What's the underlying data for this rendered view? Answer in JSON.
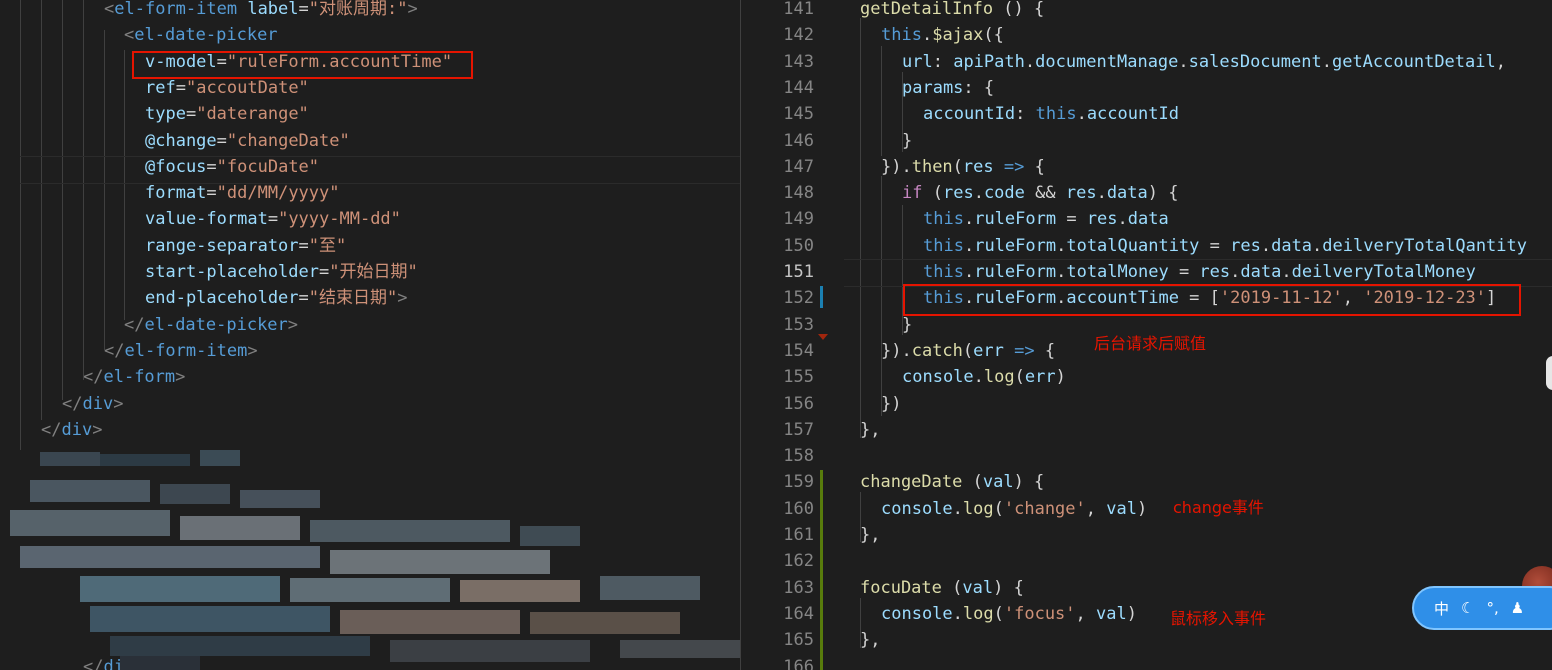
{
  "left_code": [
    [
      [
        "pn",
        "<"
      ],
      [
        "tg",
        "el-form-item"
      ],
      [
        "op",
        " "
      ],
      [
        "at",
        "label"
      ],
      [
        "op",
        "="
      ],
      [
        "st",
        "\"对账周期:\""
      ],
      [
        "pn",
        ">"
      ]
    ],
    [
      [
        "pn",
        "<"
      ],
      [
        "tg",
        "el-date-picker"
      ]
    ],
    [
      [
        "at",
        "v-model"
      ],
      [
        "op",
        "="
      ],
      [
        "st",
        "\"ruleForm.accountTime\""
      ]
    ],
    [
      [
        "at",
        "ref"
      ],
      [
        "op",
        "="
      ],
      [
        "st",
        "\"accoutDate\""
      ]
    ],
    [
      [
        "at",
        "type"
      ],
      [
        "op",
        "="
      ],
      [
        "st",
        "\"daterange\""
      ]
    ],
    [
      [
        "at",
        "@change"
      ],
      [
        "op",
        "="
      ],
      [
        "st",
        "\"changeDate\""
      ]
    ],
    [
      [
        "at",
        "@focus"
      ],
      [
        "op",
        "="
      ],
      [
        "st",
        "\"focuDate\""
      ]
    ],
    [
      [
        "at",
        "format"
      ],
      [
        "op",
        "="
      ],
      [
        "st",
        "\"dd/MM/yyyy\""
      ]
    ],
    [
      [
        "at",
        "value-format"
      ],
      [
        "op",
        "="
      ],
      [
        "st",
        "\"yyyy-MM-dd\""
      ]
    ],
    [
      [
        "at",
        "range-separator"
      ],
      [
        "op",
        "="
      ],
      [
        "st",
        "\"至\""
      ]
    ],
    [
      [
        "at",
        "start-placeholder"
      ],
      [
        "op",
        "="
      ],
      [
        "st",
        "\"开始日期\""
      ]
    ],
    [
      [
        "at",
        "end-placeholder"
      ],
      [
        "op",
        "="
      ],
      [
        "st",
        "\"结束日期\""
      ],
      [
        "pn",
        ">"
      ]
    ],
    [
      [
        "pn",
        "</"
      ],
      [
        "tg",
        "el-date-picker"
      ],
      [
        "pn",
        ">"
      ]
    ],
    [
      [
        "pn",
        "</"
      ],
      [
        "tg",
        "el-form-item"
      ],
      [
        "pn",
        ">"
      ]
    ],
    [
      [
        "pn",
        "</"
      ],
      [
        "tg",
        "el-form"
      ],
      [
        "pn",
        ">"
      ]
    ],
    [
      [
        "pn",
        "</"
      ],
      [
        "tg",
        "div"
      ],
      [
        "pn",
        ">"
      ]
    ],
    [
      [
        "pn",
        "</"
      ],
      [
        "tg",
        "div"
      ],
      [
        "pn",
        ">"
      ]
    ],
    [
      [
        "pn",
        "</"
      ],
      [
        "tg",
        "div"
      ],
      [
        "pn",
        ">"
      ]
    ]
  ],
  "right_code": [
    {
      "n": "141",
      "t": [
        [
          "fn",
          "getDetailInfo"
        ],
        [
          "op",
          " () {"
        ]
      ]
    },
    {
      "n": "142",
      "t": [
        [
          "tg",
          "this"
        ],
        [
          "op",
          "."
        ],
        [
          "fn",
          "$ajax"
        ],
        [
          "op",
          "({"
        ]
      ]
    },
    {
      "n": "143",
      "t": [
        [
          "at",
          "url"
        ],
        [
          "op",
          ": "
        ],
        [
          "at",
          "apiPath"
        ],
        [
          "op",
          "."
        ],
        [
          "at",
          "documentManage"
        ],
        [
          "op",
          "."
        ],
        [
          "at",
          "salesDocument"
        ],
        [
          "op",
          "."
        ],
        [
          "at",
          "getAccountDetail"
        ],
        [
          "op",
          ","
        ]
      ]
    },
    {
      "n": "144",
      "t": [
        [
          "at",
          "params"
        ],
        [
          "op",
          ": {"
        ]
      ]
    },
    {
      "n": "145",
      "t": [
        [
          "at",
          "accountId"
        ],
        [
          "op",
          ": "
        ],
        [
          "tg",
          "this"
        ],
        [
          "op",
          "."
        ],
        [
          "at",
          "accountId"
        ]
      ]
    },
    {
      "n": "146",
      "t": [
        [
          "op",
          "}"
        ]
      ]
    },
    {
      "n": "147",
      "t": [
        [
          "op",
          "})."
        ],
        [
          "fn",
          "then"
        ],
        [
          "op",
          "("
        ],
        [
          "at",
          "res"
        ],
        [
          "op",
          " "
        ],
        [
          "tg",
          "=>"
        ],
        [
          "op",
          " {"
        ]
      ]
    },
    {
      "n": "148",
      "t": [
        [
          "kw",
          "if"
        ],
        [
          "op",
          " ("
        ],
        [
          "at",
          "res"
        ],
        [
          "op",
          "."
        ],
        [
          "at",
          "code"
        ],
        [
          "op",
          " && "
        ],
        [
          "at",
          "res"
        ],
        [
          "op",
          "."
        ],
        [
          "at",
          "data"
        ],
        [
          "op",
          ") {"
        ]
      ]
    },
    {
      "n": "149",
      "t": [
        [
          "tg",
          "this"
        ],
        [
          "op",
          "."
        ],
        [
          "at",
          "ruleForm"
        ],
        [
          "op",
          " = "
        ],
        [
          "at",
          "res"
        ],
        [
          "op",
          "."
        ],
        [
          "at",
          "data"
        ]
      ]
    },
    {
      "n": "150",
      "t": [
        [
          "tg",
          "this"
        ],
        [
          "op",
          "."
        ],
        [
          "at",
          "ruleForm"
        ],
        [
          "op",
          "."
        ],
        [
          "at",
          "totalQuantity"
        ],
        [
          "op",
          " = "
        ],
        [
          "at",
          "res"
        ],
        [
          "op",
          "."
        ],
        [
          "at",
          "data"
        ],
        [
          "op",
          "."
        ],
        [
          "at",
          "deilveryTotalQantity"
        ]
      ]
    },
    {
      "n": "151",
      "t": [
        [
          "tg",
          "this"
        ],
        [
          "op",
          "."
        ],
        [
          "at",
          "ruleForm"
        ],
        [
          "op",
          "."
        ],
        [
          "at",
          "totalMoney"
        ],
        [
          "op",
          " = "
        ],
        [
          "at",
          "res"
        ],
        [
          "op",
          "."
        ],
        [
          "at",
          "data"
        ],
        [
          "op",
          "."
        ],
        [
          "at",
          "deilveryTotalMoney"
        ]
      ]
    },
    {
      "n": "152",
      "t": [
        [
          "tg",
          "this"
        ],
        [
          "op",
          "."
        ],
        [
          "at",
          "ruleForm"
        ],
        [
          "op",
          "."
        ],
        [
          "at",
          "accountTime"
        ],
        [
          "op",
          " = ["
        ],
        [
          "st",
          "'2019-11-12'"
        ],
        [
          "op",
          ", "
        ],
        [
          "st",
          "'2019-12-23'"
        ],
        [
          "op",
          "]"
        ]
      ]
    },
    {
      "n": "153",
      "t": [
        [
          "op",
          "}"
        ]
      ]
    },
    {
      "n": "154",
      "t": [
        [
          "op",
          "})."
        ],
        [
          "fn",
          "catch"
        ],
        [
          "op",
          "("
        ],
        [
          "at",
          "err"
        ],
        [
          "op",
          " "
        ],
        [
          "tg",
          "=>"
        ],
        [
          "op",
          " {"
        ]
      ]
    },
    {
      "n": "155",
      "t": [
        [
          "at",
          "console"
        ],
        [
          "op",
          "."
        ],
        [
          "fn",
          "log"
        ],
        [
          "op",
          "("
        ],
        [
          "at",
          "err"
        ],
        [
          "op",
          ")"
        ]
      ]
    },
    {
      "n": "156",
      "t": [
        [
          "op",
          "})"
        ]
      ]
    },
    {
      "n": "157",
      "t": [
        [
          "op",
          "},"
        ]
      ]
    },
    {
      "n": "158",
      "t": []
    },
    {
      "n": "159",
      "t": [
        [
          "fn",
          "changeDate"
        ],
        [
          "op",
          " ("
        ],
        [
          "at",
          "val"
        ],
        [
          "op",
          ") {"
        ]
      ]
    },
    {
      "n": "160",
      "t": [
        [
          "at",
          "console"
        ],
        [
          "op",
          "."
        ],
        [
          "fn",
          "log"
        ],
        [
          "op",
          "("
        ],
        [
          "st",
          "'change'"
        ],
        [
          "op",
          ", "
        ],
        [
          "at",
          "val"
        ],
        [
          "op",
          ")"
        ]
      ]
    },
    {
      "n": "161",
      "t": [
        [
          "op",
          "},"
        ]
      ]
    },
    {
      "n": "162",
      "t": []
    },
    {
      "n": "163",
      "t": [
        [
          "fn",
          "focuDate"
        ],
        [
          "op",
          " ("
        ],
        [
          "at",
          "val"
        ],
        [
          "op",
          ") {"
        ]
      ]
    },
    {
      "n": "164",
      "t": [
        [
          "at",
          "console"
        ],
        [
          "op",
          "."
        ],
        [
          "fn",
          "log"
        ],
        [
          "op",
          "("
        ],
        [
          "st",
          "'focus'"
        ],
        [
          "op",
          ", "
        ],
        [
          "at",
          "val"
        ],
        [
          "op",
          ")"
        ]
      ]
    },
    {
      "n": "165",
      "t": [
        [
          "op",
          "},"
        ]
      ]
    },
    {
      "n": "166",
      "t": []
    }
  ],
  "active_line": "151",
  "annotations": {
    "backend": "后台请求后赋值",
    "change": "change事件",
    "focus": "鼠标移入事件"
  },
  "ime": {
    "lang": "中",
    "moon": "☾",
    "punct": "°,",
    "user": "♟"
  },
  "colors": {
    "background": "#1e1e1e",
    "annotation": "#e51400",
    "tag": "#569cd6",
    "attr": "#9cdcfe",
    "string": "#ce9178",
    "function": "#dcdcaa",
    "keyword": "#c586c0"
  }
}
